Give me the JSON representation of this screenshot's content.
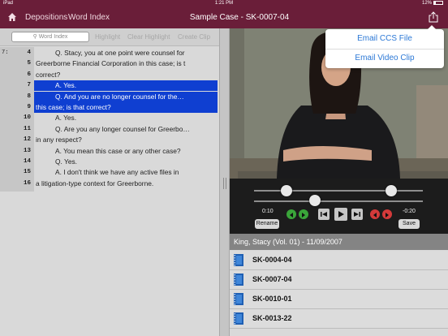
{
  "statusbar": {
    "device": "iPad",
    "time": "1:21 PM",
    "battery": "12%"
  },
  "nav": {
    "depositions": "Depositions",
    "word_index": "Word Index",
    "title": "Sample Case - SK-0007-04"
  },
  "toolbar": {
    "search_placeholder": "Word Index",
    "highlight": "Highlight",
    "clear_highlight": "Clear Highlight",
    "create_clip": "Create Clip"
  },
  "transcript": {
    "page_label": "7:",
    "lines": [
      {
        "num": "4",
        "text": "Q.   Stacy, you at one point were counsel for"
      },
      {
        "num": "5",
        "text": "Greerborne Financial Corporation in this case; is t"
      },
      {
        "num": "6",
        "text": "correct?"
      },
      {
        "num": "7",
        "text": "A.   Yes."
      },
      {
        "num": "8",
        "text": "Q.   And you are no longer counsel for the…"
      },
      {
        "num": "9",
        "text": "this case; is that correct?"
      },
      {
        "num": "10",
        "text": "A.   Yes."
      },
      {
        "num": "11",
        "text": "Q.   Are you any longer counsel for Greerbo…"
      },
      {
        "num": "12",
        "text": "in any respect?"
      },
      {
        "num": "13",
        "text": "A.   You mean this case or any other case?"
      },
      {
        "num": "14",
        "text": "Q.   Yes."
      },
      {
        "num": "15",
        "text": "A.   I don't think we have any active files in"
      },
      {
        "num": "16",
        "text": "a litigation-type context for Greerborne."
      }
    ]
  },
  "player": {
    "time_elapsed": "0:10",
    "time_remaining": "-0:20",
    "rename": "Rename",
    "save": "Save"
  },
  "list": {
    "header": "King, Stacy (Vol. 01) - 11/09/2007",
    "items": [
      {
        "label": "SK-0004-04"
      },
      {
        "label": "SK-0007-04"
      },
      {
        "label": "SK-0010-01"
      },
      {
        "label": "SK-0013-22"
      }
    ]
  },
  "share_menu": {
    "email_ccs": "Email CCS File",
    "email_video": "Email Video Clip"
  },
  "colors": {
    "nav_bar": "#6a1e39",
    "selection": "#0f3fd1",
    "menu_text": "#2b78d6"
  },
  "icons": {
    "home": "home-icon",
    "share": "share-icon",
    "file": "video-file-icon"
  }
}
